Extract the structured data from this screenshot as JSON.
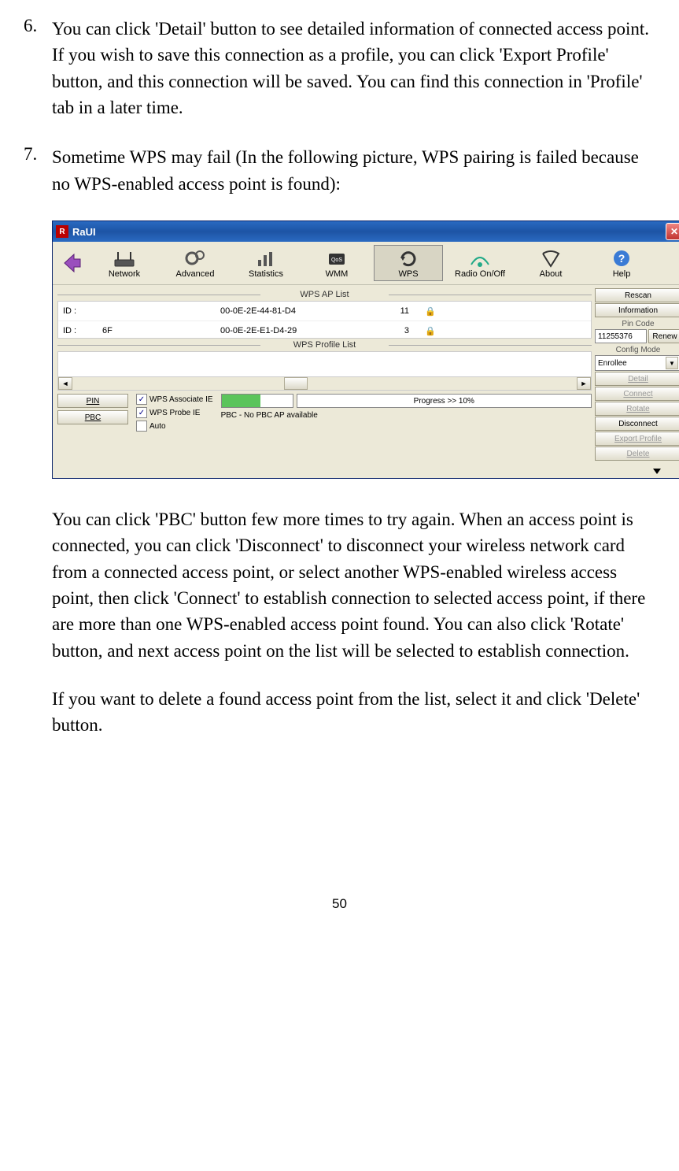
{
  "list": {
    "item6": {
      "num": "6.",
      "text": "You can click 'Detail' button to see detailed information of connected access point. If you wish to save this connection as a profile, you can click 'Export Profile' button, and this connection will be saved. You can find this connection in 'Profile' tab in a later time."
    },
    "item7": {
      "num": "7.",
      "text": "Sometime WPS may fail (In the following picture, WPS pairing is failed because no WPS-enabled access point is found):"
    }
  },
  "screenshot": {
    "title": "RaUI",
    "toolbar": {
      "network": "Network",
      "advanced": "Advanced",
      "statistics": "Statistics",
      "wmm": "WMM",
      "wps": "WPS",
      "radio": "Radio On/Off",
      "about": "About",
      "help": "Help"
    },
    "labels": {
      "aplist": "WPS AP List",
      "profilelist": "WPS Profile List",
      "pincode": "Pin Code",
      "configmode": "Config Mode"
    },
    "aprows": [
      {
        "id": "ID :",
        "ssid": "",
        "mac": "00-0E-2E-44-81-D4",
        "ch": "11",
        "locked": true
      },
      {
        "id": "ID :",
        "ssid": "6F",
        "mac": "00-0E-2E-E1-D4-29",
        "ch": "3",
        "locked": true
      }
    ],
    "buttons": {
      "pin": "PIN",
      "pbc": "PBC",
      "rescan": "Rescan",
      "information": "Information",
      "renew": "Renew",
      "detail": "Detail",
      "connect": "Connect",
      "rotate": "Rotate",
      "disconnect": "Disconnect",
      "export": "Export Profile",
      "delete": "Delete"
    },
    "checkboxes": {
      "associate": "WPS Associate IE",
      "probe": "WPS Probe IE",
      "auto": "Auto"
    },
    "progress": {
      "text": "Progress >> 10%",
      "status": "PBC - No PBC AP available"
    },
    "pin": "11255376",
    "configmode": "Enrollee"
  },
  "para1": "You can click 'PBC' button few more times to try again. When an access point is connected, you can click 'Disconnect' to disconnect your wireless network card from a connected access point, or select another WPS-enabled wireless access point, then click 'Connect' to establish connection to selected access point, if there are more than one WPS-enabled access point found. You can also click 'Rotate' button, and next access point on the list will be selected to establish connection.",
  "para2": "If you want to delete a found access point from the list, select it and click 'Delete' button.",
  "pagenum": "50"
}
